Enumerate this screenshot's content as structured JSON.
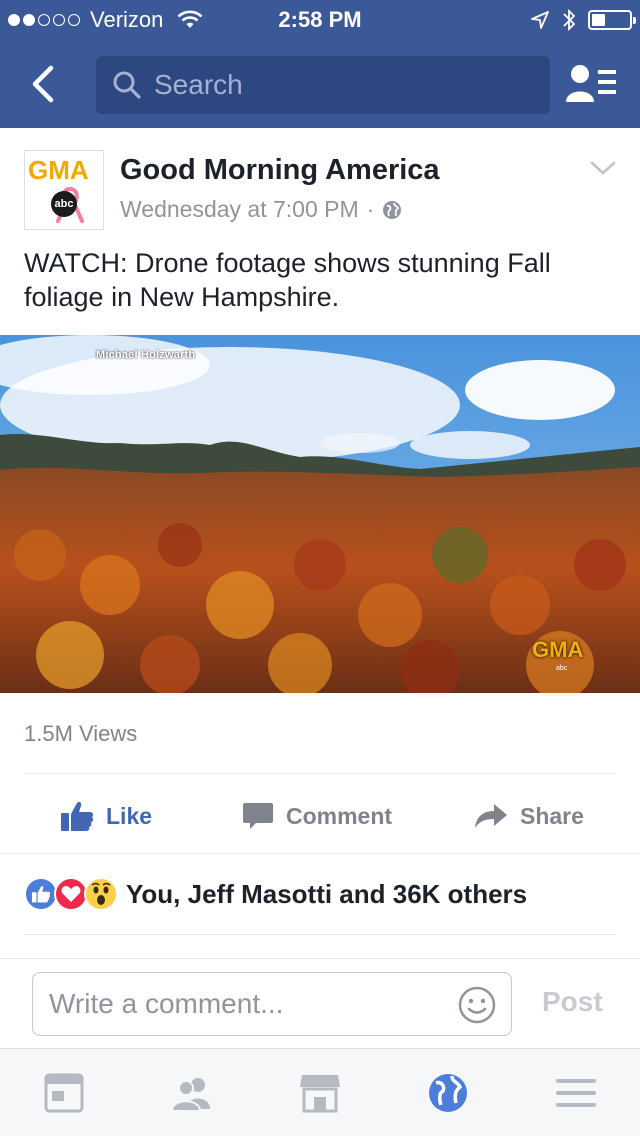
{
  "status_bar": {
    "carrier": "Verizon",
    "time": "2:58 PM",
    "signal_bars_filled": 2,
    "signal_bars_total": 5,
    "battery_level": 0.35
  },
  "nav": {
    "search_placeholder": "Search",
    "icons": [
      "back-chevron-icon",
      "search-icon",
      "friend-requests-icon"
    ]
  },
  "post": {
    "page_name": "Good Morning America",
    "logo_text": "GMA",
    "logo_network": "abc",
    "timestamp": "Wednesday at 7:00 PM",
    "separator": "·",
    "caption": "WATCH: Drone footage shows stunning Fall foliage in New Hampshire.",
    "video": {
      "credit": "Michael Holzwarth",
      "watermark": "GMA",
      "watermark_network": "abc"
    },
    "views": "1.5M Views",
    "actions": {
      "like": "Like",
      "comment": "Comment",
      "share": "Share"
    },
    "reactions": {
      "types": [
        "like",
        "love",
        "wow"
      ],
      "summary": "You, Jeff Masotti and 36K others"
    }
  },
  "composer": {
    "placeholder": "Write a comment...",
    "post_label": "Post"
  },
  "tab_bar": {
    "tabs": [
      "news-feed",
      "friends",
      "marketplace",
      "notifications-globe",
      "menu"
    ],
    "active": "notifications-globe"
  },
  "colors": {
    "brand_blue": "#3b5998",
    "search_bg": "#2d4780",
    "link_blue": "#4267b2",
    "active_tab": "#4c7ddb",
    "muted_text": "#90949c",
    "gma_gold": "#f2a900"
  }
}
